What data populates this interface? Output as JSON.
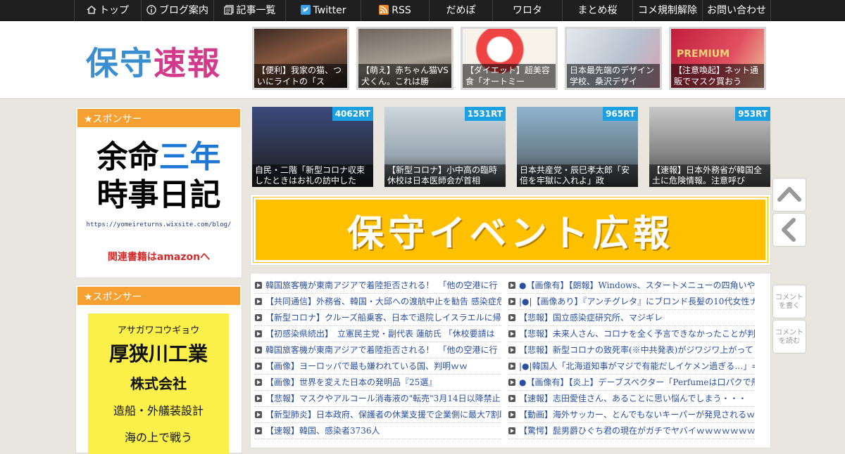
{
  "nav": {
    "items": [
      {
        "label": "トップ",
        "icon": "home-icon"
      },
      {
        "label": "ブログ案内",
        "icon": "info-icon"
      },
      {
        "label": "記事一覧",
        "icon": "list-icon"
      },
      {
        "label": "Twitter",
        "icon": "twitter-icon"
      },
      {
        "label": "RSS",
        "icon": "rss-icon"
      },
      {
        "label": "だめぽ"
      },
      {
        "label": "ワロタ"
      },
      {
        "label": "まとめ桜"
      },
      {
        "label": "コメ規制解除"
      },
      {
        "label": "お問い合わせ"
      }
    ]
  },
  "header": {
    "logo": "保守速報",
    "thumbs": [
      {
        "caption": "【便利】我家の猫、ついにライトの「ス"
      },
      {
        "caption": "【萌え】赤ちゃん猫VS犬くん。これは勝"
      },
      {
        "caption": "【ダイエット】超美容食「オートミー"
      },
      {
        "caption": "日本最先端のデザイン学校、桑沢デザイ"
      },
      {
        "caption": "【注意喚起】ネット通販でマスク買おう",
        "badge": "PREMIUM"
      }
    ]
  },
  "sidebar": {
    "sponsor1": {
      "heading": "★スポンサー",
      "line1a": "余命",
      "line1b": "三年",
      "line2": "時事日記",
      "url": "https://yomeireturns.wixsite.com/blog/",
      "amazon": "関連書籍はamazonへ"
    },
    "sponsor2": {
      "heading": "★スポンサー",
      "kana": "アサガワコウギョウ",
      "name": "厚狭川工業",
      "type": "株式会社",
      "biz": "造船・外艤装設計",
      "tail": "海の上で戦う"
    }
  },
  "news": [
    {
      "rt": "4062RT",
      "caption": "自民・二階「新型コロナ収束したときはお礼の訪中した"
    },
    {
      "rt": "1531RT",
      "caption": "【新型コロナ】小中高の臨時休校は日本医師会が首相"
    },
    {
      "rt": "965RT",
      "caption": "日本共産党・辰巳孝太郎「安倍を牢獄に入れよ」政"
    },
    {
      "rt": "953RT",
      "caption": "【速報】日本外務省が韓国全土に危険情報。注意呼び"
    }
  ],
  "banner": {
    "text": "保守イベント広報"
  },
  "list_left": [
    "韓国旅客機が東南アジアで着陸拒否される！　「他の空港に行",
    "【共同通信】外務省、韓国・大邱への渡航中止を勧告 感染症危",
    "【新型コロナ】クルーズ船乗客、日本で退院しイスラエルに帰",
    "【初感染県続出】　立憲民主党・副代表 蓮舫氏 「休校要請は",
    "韓国旅客機が東南アジアで着陸拒否される！　「他の空港に行",
    "【画像】ヨーロッパで最も嫌われている国、判明ｗｗ",
    "【画像】世界を変えた日本の発明品『25選』",
    "【悲報】マスクやアルコール消毒液の\"転売\"3月14日以降禁止",
    "【新型肺炎】日本政府、保護者の休業支援で企業側に最大7割助",
    "【速報】韓国、感染者3736人"
  ],
  "list_right": [
    "●【画像有】【朗報】Windows、スタートメニューの四角いや",
    "|●|【画像あり】『アンチグレタ』にブロンド長髪の10代女性ナ",
    "【悲報】国立感染症研究所、マジギレ",
    "【悲報】未来人さん、コロナを全く予言できなかったことが判",
    "【悲報】新型コロナの致死率(※中共発表)がジワジワ上がって",
    "|●|韓国人「北海道知事がマジで有能だしイケメン過ぎる…」=",
    "●【画像有】【炎上】デーブスペクター「Perfumeは口パクで飛",
    "【速報】志田愛佳さん、あることに思い悩んでしまう・・・",
    "【動画】海外サッカー、とんでもないキーパーが発見されるｗ",
    "【驚愕】髭男爵ひぐち君の現在がガチでヤバイｗｗｗｗｗｗｗ"
  ],
  "side_buttons": {
    "write": "コメントを書く",
    "read": "コメントを読む"
  },
  "colors": {
    "accent_orange": "#f5a030",
    "rt_blue": "#1ba1e2",
    "banner_yellow": "#ffc000",
    "link_blue": "#2a4f9e"
  }
}
